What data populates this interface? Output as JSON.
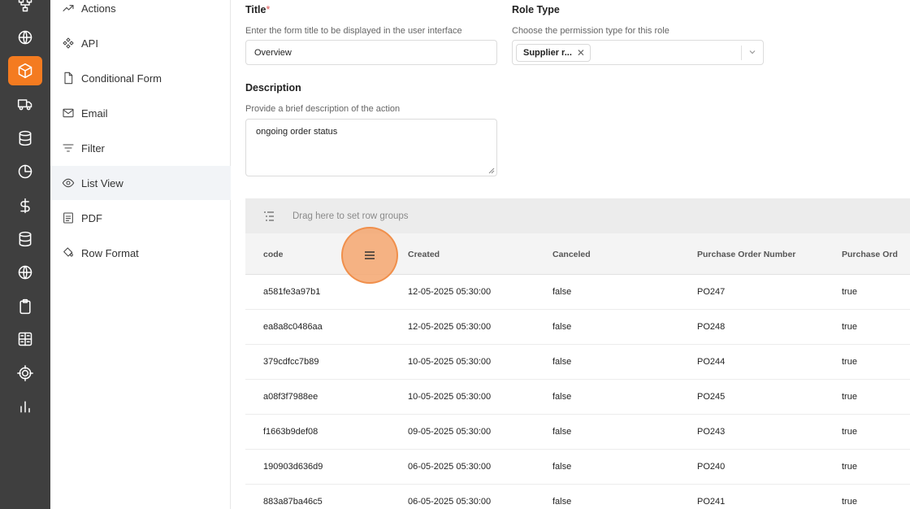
{
  "rail": {
    "items": [
      {
        "icon": "hierarchy-icon"
      },
      {
        "icon": "globe-icon"
      },
      {
        "icon": "box-icon",
        "active": true
      },
      {
        "icon": "truck-icon"
      },
      {
        "icon": "database-icon"
      },
      {
        "icon": "pie-chart-icon"
      },
      {
        "icon": "dollar-icon"
      },
      {
        "icon": "database-icon"
      },
      {
        "icon": "globe-icon"
      },
      {
        "icon": "clipboard-icon"
      },
      {
        "icon": "dashboard-icon"
      },
      {
        "icon": "target-icon"
      },
      {
        "icon": "bar-chart-icon"
      }
    ],
    "accent_color": "#f47b20"
  },
  "subnav": {
    "items": [
      {
        "label": "Actions",
        "icon": "trend-icon"
      },
      {
        "label": "API",
        "icon": "api-icon"
      },
      {
        "label": "Conditional Form",
        "icon": "document-icon"
      },
      {
        "label": "Email",
        "icon": "mail-icon"
      },
      {
        "label": "Filter",
        "icon": "filter-icon"
      },
      {
        "label": "List View",
        "icon": "eye-icon",
        "selected": true
      },
      {
        "label": "PDF",
        "icon": "pdf-icon"
      },
      {
        "label": "Row Format",
        "icon": "paint-bucket-icon"
      }
    ]
  },
  "form": {
    "title_label": "Title",
    "title_required_mark": "*",
    "title_hint": "Enter the form title to be displayed in the user interface",
    "title_value": "Overview",
    "role_type_label": "Role Type",
    "role_type_hint": "Choose the permission type for this role",
    "role_type_chip": "Supplier r...",
    "role_type_chip_remove": "✕",
    "description_label": "Description",
    "description_hint": "Provide a brief description of the action",
    "description_value": "ongoing order status"
  },
  "grid": {
    "group_bar_text": "Drag here to set row groups",
    "columns": [
      "code",
      "Created",
      "Canceled",
      "Purchase Order Number",
      "Purchase Ord"
    ],
    "rows": [
      [
        "a581fe3a97b1",
        "12-05-2025 05:30:00",
        "false",
        "PO247",
        "true"
      ],
      [
        "ea8a8c0486aa",
        "12-05-2025 05:30:00",
        "false",
        "PO248",
        "true"
      ],
      [
        "379cdfcc7b89",
        "10-05-2025 05:30:00",
        "false",
        "PO244",
        "true"
      ],
      [
        "a08f3f7988ee",
        "10-05-2025 05:30:00",
        "false",
        "PO245",
        "true"
      ],
      [
        "f1663b9def08",
        "09-05-2025 05:30:00",
        "false",
        "PO243",
        "true"
      ],
      [
        "190903d636d9",
        "06-05-2025 05:30:00",
        "false",
        "PO240",
        "true"
      ],
      [
        "883a87ba46c5",
        "06-05-2025 05:30:00",
        "false",
        "PO241",
        "true"
      ]
    ]
  }
}
